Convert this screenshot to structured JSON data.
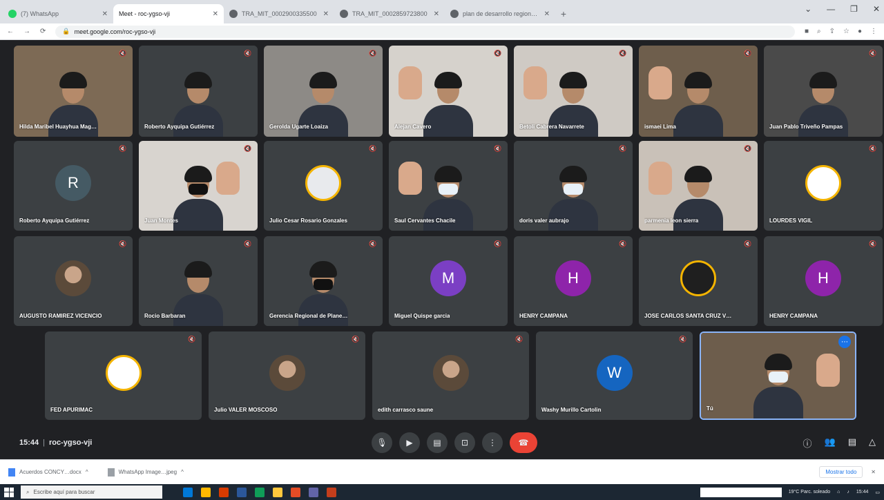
{
  "browser": {
    "tabs": [
      {
        "title": "(7) WhatsApp",
        "favicon": "whatsapp-icon",
        "active": false
      },
      {
        "title": "Meet - roc-ygso-vji",
        "favicon": "meet-icon",
        "active": true
      },
      {
        "title": "TRA_MIT_0002900335500",
        "favicon": "globe-icon",
        "active": false
      },
      {
        "title": "TRA_MIT_0002859723800",
        "favicon": "globe-icon",
        "active": false
      },
      {
        "title": "plan de desarrollo regional con…",
        "favicon": "globe-icon",
        "active": false
      }
    ],
    "url": "meet.google.com/roc-ygso-vji"
  },
  "meeting": {
    "time": "15:44",
    "code": "roc-ygso-vji",
    "participants": [
      {
        "name": "Hilda Maribel Huayhua Mag…",
        "kind": "video",
        "bg": "#7d6a55"
      },
      {
        "name": "Roberto Ayquipa Gutiérrez",
        "kind": "video",
        "bg": "#3c4043"
      },
      {
        "name": "Gerolda Ugarte Loaiza",
        "kind": "video",
        "bg": "#8d8a86"
      },
      {
        "name": "Alejan Cavero",
        "kind": "video",
        "bg": "#d6d2cc"
      },
      {
        "name": "Betoli Cabrera Navarrete",
        "kind": "video",
        "bg": "#cfcac4"
      },
      {
        "name": "ismaei Lima",
        "kind": "video",
        "bg": "#6e5e4c"
      },
      {
        "name": "Juan Pablo Triveño Pampas",
        "kind": "video",
        "bg": "#4a4a4a"
      },
      {
        "name": "Roberto Ayquipa Gutiérrez",
        "kind": "letter",
        "letter": "R",
        "color": "#455a64"
      },
      {
        "name": "Juan Montes",
        "kind": "video",
        "bg": "#d8d4cf"
      },
      {
        "name": "Julio Cesar Rosario Gonzales",
        "kind": "logo",
        "color": "#e8eaed"
      },
      {
        "name": "Saul Cervantes Chacile",
        "kind": "video",
        "bg": "#3c4043"
      },
      {
        "name": "doris valer aubrajo",
        "kind": "video",
        "bg": "#3c4043"
      },
      {
        "name": "parmenia leon sierra",
        "kind": "video",
        "bg": "#c9c1b8"
      },
      {
        "name": "LOURDES VIGIL",
        "kind": "logo",
        "color": "#ffffff"
      },
      {
        "name": "AUGUSTO RAMIREZ VICENCIO",
        "kind": "photo"
      },
      {
        "name": "Rocio Barbaran",
        "kind": "video",
        "bg": "#3c4043"
      },
      {
        "name": "Gerencia Regional de Plane…",
        "kind": "video",
        "bg": "#3c4043"
      },
      {
        "name": "Miguel Quispe garcia",
        "kind": "letter",
        "letter": "M",
        "color": "#7b3fc4"
      },
      {
        "name": "HENRY CAMPANA",
        "kind": "letter",
        "letter": "H",
        "color": "#8e24aa"
      },
      {
        "name": "JOSE CARLOS SANTA CRUZ V…",
        "kind": "logo",
        "color": "#1f1f1f"
      },
      {
        "name": "HENRY CAMPANA",
        "kind": "letter",
        "letter": "H",
        "color": "#8e24aa"
      },
      {
        "name": "FED APURIMAC",
        "kind": "logo",
        "color": "#ffffff"
      },
      {
        "name": "Julio VALER MOSCOSO",
        "kind": "photo"
      },
      {
        "name": "edith carrasco saune",
        "kind": "photo"
      },
      {
        "name": "Washy Murillo Cartolin",
        "kind": "letter",
        "letter": "W",
        "color": "#1565c0"
      },
      {
        "name": "Tú",
        "kind": "self",
        "bg": "#6d5d4c"
      }
    ]
  },
  "downloads": [
    {
      "name": "Acuerdos CONCY…docx"
    },
    {
      "name": "WhatsApp Image…jpeg"
    }
  ],
  "downloads_show_all": "Mostrar todo",
  "taskbar": {
    "search_placeholder": "Escribe aquí para buscar",
    "weather": "19°C Parc. soleado",
    "time": "15:44"
  }
}
